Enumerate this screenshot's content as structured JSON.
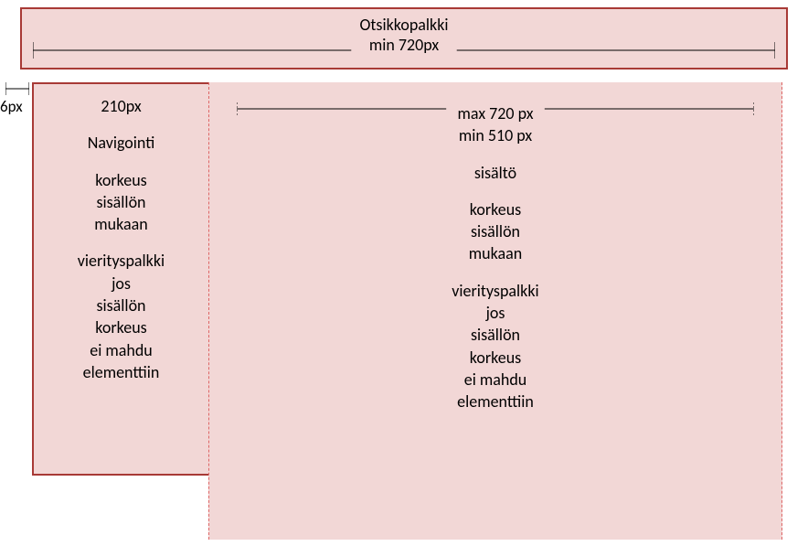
{
  "header": {
    "title": "Otsikkopalkki",
    "width_label": "min 720px"
  },
  "nav": {
    "width_label": "210px",
    "title": "Navigointi",
    "height_desc_1": "korkeus",
    "height_desc_2": "sisällön",
    "height_desc_3": "mukaan",
    "scroll_1": "vierityspalkki",
    "scroll_2": "jos",
    "scroll_3": "sisällön",
    "scroll_4": "korkeus",
    "scroll_5": "ei mahdu",
    "scroll_6": "elementtiin"
  },
  "content": {
    "max_label": "max 720 px",
    "min_label": "min 510 px",
    "title": "sisältö",
    "height_desc_1": "korkeus",
    "height_desc_2": "sisällön",
    "height_desc_3": "mukaan",
    "scroll_1": "vierityspalkki",
    "scroll_2": "jos",
    "scroll_3": "sisällön",
    "scroll_4": "korkeus",
    "scroll_5": "ei mahdu",
    "scroll_6": "elementtiin"
  },
  "offset_label": "6px"
}
